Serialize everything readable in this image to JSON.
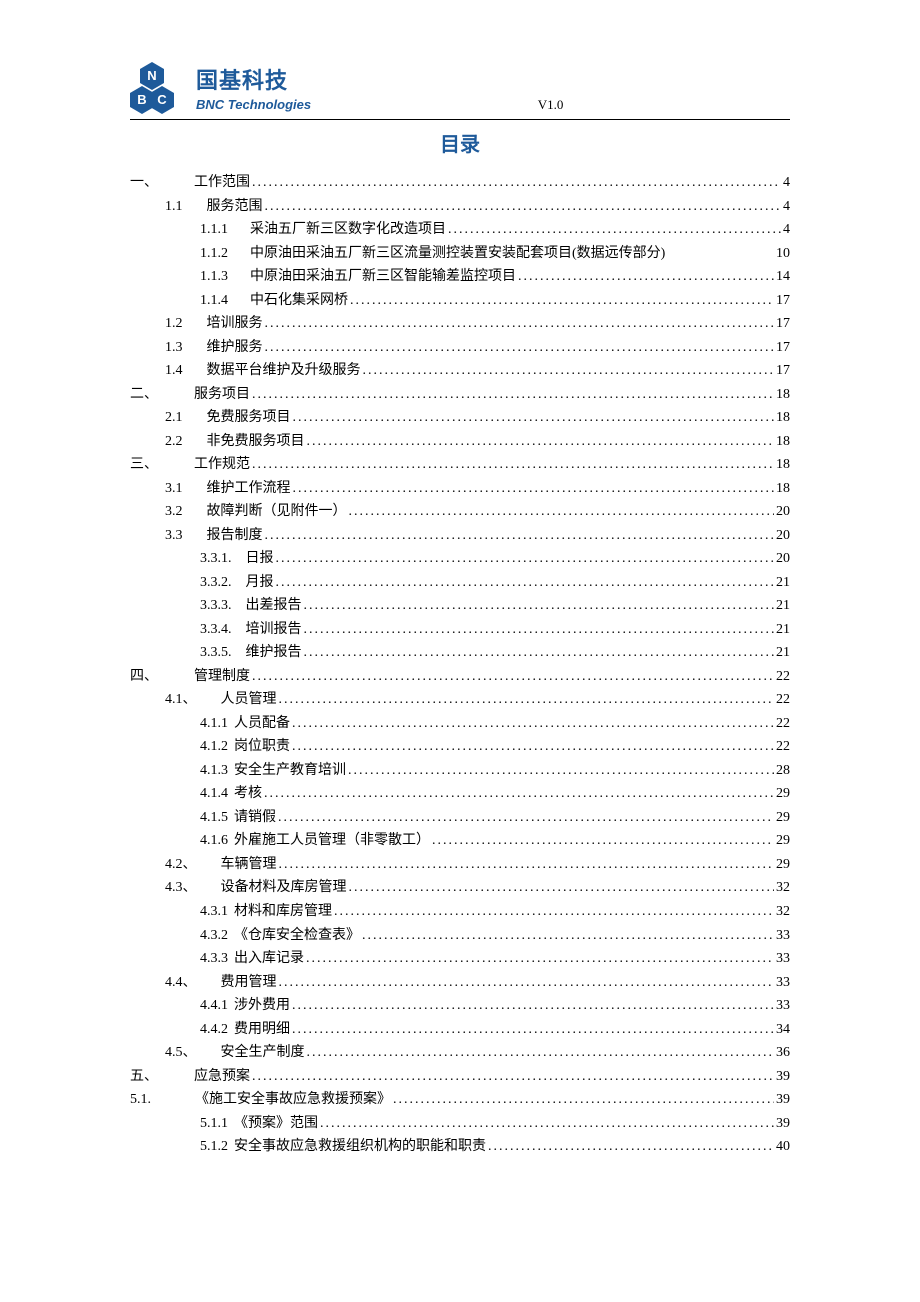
{
  "header": {
    "logo_cn": "国基科技",
    "logo_en": "BNC Technologies",
    "version": "V1.0"
  },
  "doc_title": "目录",
  "toc": [
    {
      "indent": 0,
      "num": "一、",
      "gap": 36,
      "label": "工作范围",
      "dots": true,
      "page": "4"
    },
    {
      "indent": 1,
      "num": "1.1",
      "gap": 24,
      "label": "服务范围",
      "dots": true,
      "page": "4"
    },
    {
      "indent": 2,
      "num": "1.1.1",
      "gap": 22,
      "label": "采油五厂新三区数字化改造项目",
      "dots": true,
      "page": "4"
    },
    {
      "indent": 2,
      "num": "1.1.2",
      "gap": 22,
      "label": "中原油田采油五厂新三区流量测控装置安装配套项目(数据远传部分)",
      "dots": false,
      "page": "10"
    },
    {
      "indent": 2,
      "num": "1.1.3",
      "gap": 22,
      "label": "中原油田采油五厂新三区智能输差监控项目",
      "dots": true,
      "page": "14"
    },
    {
      "indent": 2,
      "num": "1.1.4",
      "gap": 22,
      "label": "中石化集采网桥",
      "dots": true,
      "page": "17"
    },
    {
      "indent": 1,
      "num": "1.2",
      "gap": 24,
      "label": "培训服务",
      "dots": true,
      "page": "17"
    },
    {
      "indent": 1,
      "num": "1.3",
      "gap": 24,
      "label": "维护服务",
      "dots": true,
      "page": "17"
    },
    {
      "indent": 1,
      "num": "1.4",
      "gap": 24,
      "label": "数据平台维护及升级服务",
      "dots": true,
      "page": "17"
    },
    {
      "indent": 0,
      "num": "二、",
      "gap": 36,
      "label": "服务项目",
      "dots": true,
      "page": "18"
    },
    {
      "indent": 1,
      "num": "2.1",
      "gap": 24,
      "label": "免费服务项目",
      "dots": true,
      "page": "18"
    },
    {
      "indent": 1,
      "num": "2.2",
      "gap": 24,
      "label": "非免费服务项目",
      "dots": true,
      "page": "18"
    },
    {
      "indent": 0,
      "num": "三、",
      "gap": 36,
      "label": "工作规范",
      "dots": true,
      "page": "18"
    },
    {
      "indent": 1,
      "num": "3.1",
      "gap": 24,
      "label": "维护工作流程",
      "dots": true,
      "page": "18"
    },
    {
      "indent": 1,
      "num": "3.2",
      "gap": 24,
      "label": "故障判断（见附件一）",
      "dots": true,
      "page": "20"
    },
    {
      "indent": 1,
      "num": "3.3",
      "gap": 24,
      "label": "报告制度",
      "dots": true,
      "page": "20"
    },
    {
      "indent": 2,
      "num": "3.3.1.",
      "gap": 14,
      "label": "日报",
      "dots": true,
      "page": "20"
    },
    {
      "indent": 2,
      "num": "3.3.2.",
      "gap": 14,
      "label": "月报",
      "dots": true,
      "page": "21"
    },
    {
      "indent": 2,
      "num": "3.3.3.",
      "gap": 14,
      "label": "出差报告",
      "dots": true,
      "page": "21"
    },
    {
      "indent": 2,
      "num": "3.3.4.",
      "gap": 14,
      "label": "培训报告",
      "dots": true,
      "page": "21"
    },
    {
      "indent": 2,
      "num": "3.3.5.",
      "gap": 14,
      "label": "维护报告",
      "dots": true,
      "page": "21"
    },
    {
      "indent": 0,
      "num": "四、",
      "gap": 36,
      "label": "管理制度",
      "dots": true,
      "page": "22"
    },
    {
      "indent": 1,
      "num": "4.1、",
      "gap": 24,
      "label": "人员管理",
      "dots": true,
      "page": "22"
    },
    {
      "indent": 2,
      "num": "4.1.1",
      "gap": 6,
      "label": "人员配备",
      "dots": true,
      "page": "22"
    },
    {
      "indent": 2,
      "num": "4.1.2",
      "gap": 6,
      "label": "岗位职责",
      "dots": true,
      "page": "22"
    },
    {
      "indent": 2,
      "num": "4.1.3",
      "gap": 6,
      "label": "安全生产教育培训",
      "dots": true,
      "page": "28"
    },
    {
      "indent": 2,
      "num": "4.1.4",
      "gap": 6,
      "label": "考核",
      "dots": true,
      "page": "29"
    },
    {
      "indent": 2,
      "num": "4.1.5",
      "gap": 6,
      "label": "请销假",
      "dots": true,
      "page": "29"
    },
    {
      "indent": 2,
      "num": "4.1.6",
      "gap": 6,
      "label": "外雇施工人员管理（非零散工）",
      "dots": true,
      "page": "29"
    },
    {
      "indent": 1,
      "num": "4.2、",
      "gap": 24,
      "label": "车辆管理",
      "dots": true,
      "page": "29"
    },
    {
      "indent": 1,
      "num": "4.3、",
      "gap": 24,
      "label": "设备材料及库房管理",
      "dots": true,
      "page": "32"
    },
    {
      "indent": 2,
      "num": "4.3.1",
      "gap": 6,
      "label": "材料和库房管理",
      "dots": true,
      "page": "32"
    },
    {
      "indent": 2,
      "num": "4.3.2",
      "gap": 6,
      "label": "《仓库安全检查表》",
      "dots": true,
      "page": "33"
    },
    {
      "indent": 2,
      "num": "4.3.3",
      "gap": 6,
      "label": "出入库记录",
      "dots": true,
      "page": "33"
    },
    {
      "indent": 1,
      "num": "4.4、",
      "gap": 24,
      "label": "费用管理",
      "dots": true,
      "page": "33"
    },
    {
      "indent": 2,
      "num": "4.4.1",
      "gap": 6,
      "label": "涉外费用",
      "dots": true,
      "page": "33"
    },
    {
      "indent": 2,
      "num": "4.4.2",
      "gap": 6,
      "label": "费用明细",
      "dots": true,
      "page": "34"
    },
    {
      "indent": 1,
      "num": "4.5、",
      "gap": 24,
      "label": "安全生产制度",
      "dots": true,
      "page": "36"
    },
    {
      "indent": 0,
      "num": "五、",
      "gap": 36,
      "label": "应急预案",
      "dots": true,
      "page": "39"
    },
    {
      "indent": 0,
      "num": "5.1.",
      "gap": 44,
      "label": "《施工安全事故应急救援预案》",
      "dots": true,
      "page": "39"
    },
    {
      "indent": 2,
      "num": "5.1.1",
      "gap": 6,
      "label": "《预案》范围",
      "dots": true,
      "page": "39"
    },
    {
      "indent": 2,
      "num": "5.1.2",
      "gap": 6,
      "label": "安全事故应急救援组织机构的职能和职责",
      "dots": true,
      "page": "40"
    }
  ]
}
